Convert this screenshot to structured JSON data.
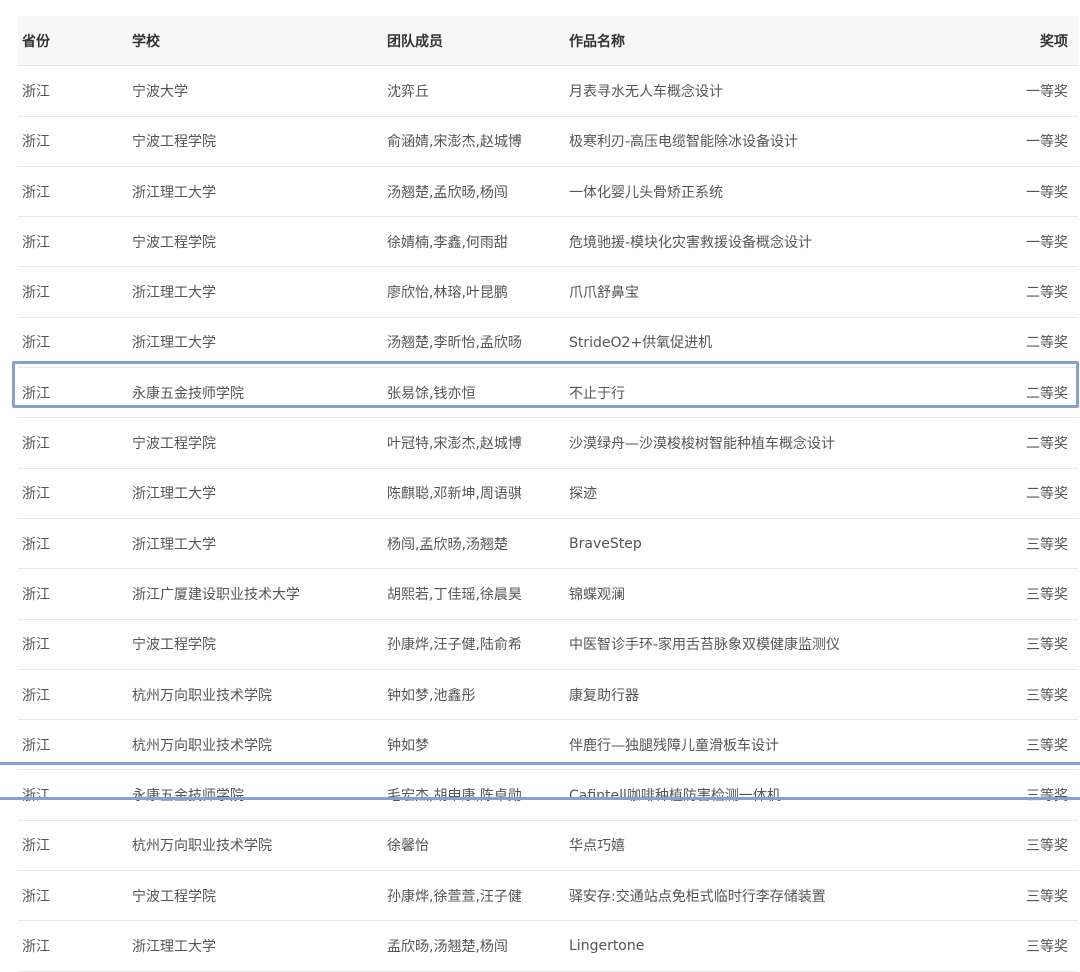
{
  "headers": {
    "province": "省份",
    "school": "学校",
    "members": "团队成员",
    "title": "作品名称",
    "award": "奖项"
  },
  "rows": [
    {
      "province": "浙江",
      "school": "宁波大学",
      "members": "沈弈丘",
      "title": "月表寻水无人车概念设计",
      "award": "一等奖"
    },
    {
      "province": "浙江",
      "school": "宁波工程学院",
      "members": "俞涵婧,宋澎杰,赵城博",
      "title": "极寒利刃-高压电缆智能除冰设备设计",
      "award": "一等奖"
    },
    {
      "province": "浙江",
      "school": "浙江理工大学",
      "members": "汤翘楚,孟欣旸,杨闯",
      "title": "一体化婴儿头骨矫正系统",
      "award": "一等奖"
    },
    {
      "province": "浙江",
      "school": "宁波工程学院",
      "members": "徐婧楠,李鑫,何雨甜",
      "title": "危境驰援-模块化灾害救援设备概念设计",
      "award": "一等奖"
    },
    {
      "province": "浙江",
      "school": "浙江理工大学",
      "members": "廖欣怡,林瑢,叶昆鹏",
      "title": "爪爪舒鼻宝",
      "award": "二等奖"
    },
    {
      "province": "浙江",
      "school": "浙江理工大学",
      "members": "汤翘楚,李昕怡,孟欣旸",
      "title": "StrideO2+供氧促进机",
      "award": "二等奖"
    },
    {
      "province": "浙江",
      "school": "永康五金技师学院",
      "members": "张易馀,钱亦恒",
      "title": "不止于行",
      "award": "二等奖"
    },
    {
      "province": "浙江",
      "school": "宁波工程学院",
      "members": "叶冠特,宋澎杰,赵城博",
      "title": "沙漠绿舟—沙漠梭梭树智能种植车概念设计",
      "award": "二等奖"
    },
    {
      "province": "浙江",
      "school": "浙江理工大学",
      "members": "陈麒聪,邓新坤,周语骐",
      "title": "探迹",
      "award": "二等奖"
    },
    {
      "province": "浙江",
      "school": "浙江理工大学",
      "members": "杨闯,孟欣旸,汤翘楚",
      "title": "BraveStep",
      "award": "三等奖"
    },
    {
      "province": "浙江",
      "school": "浙江广厦建设职业技术大学",
      "members": "胡熙若,丁佳瑶,徐晨昊",
      "title": "锦蝶观澜",
      "award": "三等奖"
    },
    {
      "province": "浙江",
      "school": "宁波工程学院",
      "members": "孙康烨,汪子健,陆俞希",
      "title": "中医智诊手环-家用舌苔脉象双模健康监测仪",
      "award": "三等奖"
    },
    {
      "province": "浙江",
      "school": "杭州万向职业技术学院",
      "members": "钟如梦,池鑫彤",
      "title": "康复助行器",
      "award": "三等奖"
    },
    {
      "province": "浙江",
      "school": "杭州万向职业技术学院",
      "members": "钟如梦",
      "title": "伴鹿行—独腿残障儿童滑板车设计",
      "award": "三等奖"
    },
    {
      "province": "浙江",
      "school": "永康五金技师学院",
      "members": "毛宏杰,胡申康,陈卓勋",
      "title": "Cafintell咖啡种植防害检测一体机",
      "award": "三等奖"
    },
    {
      "province": "浙江",
      "school": "杭州万向职业技术学院",
      "members": "徐馨怡",
      "title": "华点巧嬉",
      "award": "三等奖"
    },
    {
      "province": "浙江",
      "school": "宁波工程学院",
      "members": "孙康烨,徐萱萱,汪子健",
      "title": "驿安存:交通站点免柜式临时行李存储装置",
      "award": "三等奖"
    },
    {
      "province": "浙江",
      "school": "浙江理工大学",
      "members": "孟欣旸,汤翘楚,杨闯",
      "title": "Lingertone",
      "award": "三等奖"
    }
  ],
  "highlight_color": "#8a9ed0"
}
